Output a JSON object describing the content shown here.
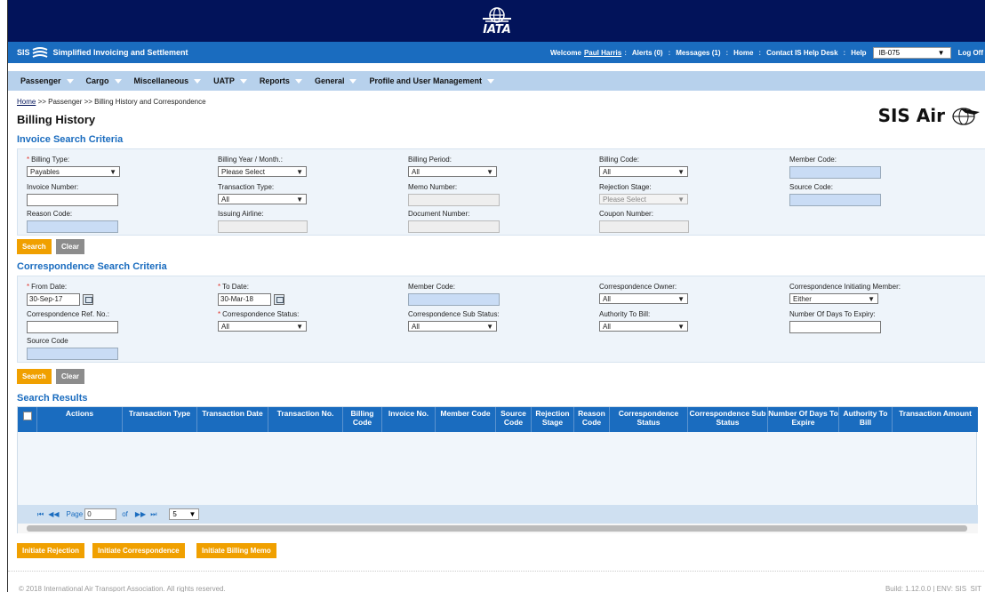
{
  "header": {
    "logo_text": "IATA"
  },
  "brand": {
    "sis": "SIS",
    "name": "Simplified Invoicing and Settlement"
  },
  "userbar": {
    "welcome": "Welcome",
    "user": "Paul Harris",
    "alerts": "Alerts (0)",
    "messages": "Messages (1)",
    "home": "Home",
    "contact": "Contact IS Help Desk",
    "help": "Help",
    "account": "IB-075",
    "logoff": "Log Off"
  },
  "menu": [
    "Passenger",
    "Cargo",
    "Miscellaneous",
    "UATP",
    "Reports",
    "General",
    "Profile and User Management"
  ],
  "breadcrumb": {
    "home": "Home",
    "rest": " >> Passenger >> Billing History and Correspondence"
  },
  "page_title": "Billing History",
  "logo_right": "SIS Air",
  "invoice_section": {
    "title": "Invoice Search Criteria",
    "billing_type": {
      "label": "Billing Type:",
      "value": "Payables"
    },
    "billing_year": {
      "label": "Billing Year / Month.:",
      "value": "Please Select"
    },
    "billing_period": {
      "label": "Billing Period:",
      "value": "All"
    },
    "billing_code": {
      "label": "Billing Code:",
      "value": "All"
    },
    "member_code": {
      "label": "Member Code:"
    },
    "invoice_number": {
      "label": "Invoice Number:"
    },
    "transaction_type": {
      "label": "Transaction Type:",
      "value": "All"
    },
    "memo_number": {
      "label": "Memo Number:"
    },
    "rejection_stage": {
      "label": "Rejection Stage:",
      "value": "Please Select"
    },
    "source_code": {
      "label": "Source Code:"
    },
    "reason_code": {
      "label": "Reason Code:"
    },
    "issuing_airline": {
      "label": "Issuing Airline:"
    },
    "document_number": {
      "label": "Document Number:"
    },
    "coupon_number": {
      "label": "Coupon Number:"
    },
    "search": "Search",
    "clear": "Clear"
  },
  "corr_section": {
    "title": "Correspondence Search Criteria",
    "from_date": {
      "label": "From Date:",
      "value": "30-Sep-17"
    },
    "to_date": {
      "label": "To Date:",
      "value": "30-Mar-18"
    },
    "member_code": {
      "label": "Member Code:"
    },
    "owner": {
      "label": "Correspondence Owner:",
      "value": "All"
    },
    "initiating": {
      "label": "Correspondence Initiating Member:",
      "value": "Either"
    },
    "ref_no": {
      "label": "Correspondence Ref. No.:"
    },
    "status": {
      "label": "Correspondence Status:",
      "value": "All"
    },
    "sub_status": {
      "label": "Correspondence Sub Status:",
      "value": "All"
    },
    "authority": {
      "label": "Authority To Bill:",
      "value": "All"
    },
    "days_expiry": {
      "label": "Number Of Days To Expiry:"
    },
    "source_code": {
      "label": "Source Code"
    },
    "search": "Search",
    "clear": "Clear"
  },
  "results": {
    "title": "Search Results",
    "columns": [
      "Actions",
      "Transaction Type",
      "Transaction Date",
      "Transaction No.",
      "Billing Code",
      "Invoice No.",
      "Member Code",
      "Source Code",
      "Rejection Stage",
      "Reason Code",
      "Correspondence Status",
      "Correspondence Sub Status",
      "Number Of Days To Expire",
      "Authority To Bill",
      "Transaction Amount"
    ],
    "pager": {
      "page_label": "Page",
      "page_value": "0",
      "of_label": "of",
      "page_size": "5"
    }
  },
  "actions": {
    "rejection": "Initiate Rejection",
    "correspondence": "Initiate Correspondence",
    "billing_memo": "Initiate Billing Memo"
  },
  "footer": {
    "copyright": "© 2018 International Air Transport Association. All rights reserved.",
    "build": "Build: 1.12.0.0 | ENV: SIS_SIT"
  }
}
